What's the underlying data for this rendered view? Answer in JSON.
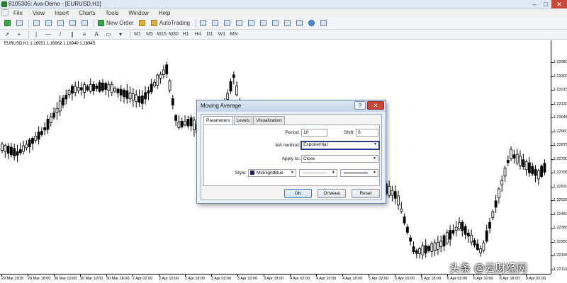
{
  "window": {
    "title": "8105305: Ava-Demo - [EURUSD,H1]",
    "controls": {
      "minimize": "–",
      "maximize": "□",
      "close": "✕"
    }
  },
  "menu": {
    "items": [
      "File",
      "View",
      "Insert",
      "Charts",
      "Tools",
      "Window",
      "Help"
    ]
  },
  "toolbar": {
    "new_order": "New Order",
    "autotrading": "AutoTrading",
    "periods": [
      "M1",
      "M5",
      "M15",
      "M30",
      "H1",
      "H4",
      "D1",
      "W1",
      "MN"
    ]
  },
  "chart": {
    "symbol_label": "EURUSD,H1  1.16951 1.16962 1.16940 1.16945",
    "price_labels": [
      "1.23380",
      "1.23300",
      "1.23215",
      "1.23130",
      "1.23045",
      "1.22960",
      "1.22875",
      "1.22790",
      "1.22705",
      "1.22620",
      "1.22535",
      "1.22450",
      "1.22365",
      "1.22280",
      "1.22195",
      "1.22110"
    ],
    "time_labels": [
      "29 Mar 2018",
      "29 Mar 18:00",
      "30 Mar 02:00",
      "30 Mar 10:00",
      "30 Mar 18:00",
      "2 Apr 02:00",
      "2 Apr 10:00",
      "2 Apr 18:00",
      "3 Apr 02:00",
      "3 Apr 10:00",
      "3 Apr 18:00",
      "4 Apr 02:00",
      "4 Apr 10:00",
      "4 Apr 18:00",
      "5 Apr 02:00",
      "5 Apr 10:00",
      "5 Apr 18:00",
      "6 Apr 02:00",
      "6 Apr 10:00",
      "6 Apr 18:00",
      "9 Apr 02:00"
    ]
  },
  "dialog": {
    "title": "Moving Average",
    "help_btn": "?",
    "close_btn": "✕",
    "tabs": [
      "Parameters",
      "Levels",
      "Visualization"
    ],
    "period_label": "Period:",
    "period_value": "10",
    "shift_label": "Shift:",
    "shift_value": "0",
    "ma_method_label": "MA method:",
    "ma_method_value": "Exponential",
    "apply_to_label": "Apply to:",
    "apply_to_value": "Close",
    "style_label": "Style:",
    "style_color_name": "MidnightBlue",
    "style_color": "#191970",
    "ok": "OK",
    "cancel": "Отмена",
    "reset": "Reset"
  },
  "watermark": "头条 @云财经网"
}
